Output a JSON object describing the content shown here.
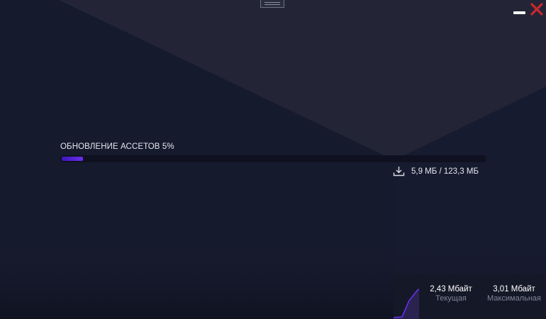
{
  "update": {
    "label": "ОБНОВЛЕНИЕ АССЕТОВ 5%",
    "progress_percent": 5,
    "downloaded": "5,9 МБ / 123,3 МБ"
  },
  "speed": {
    "current_value": "2,43 Мбайт",
    "current_caption": "Текущая",
    "max_value": "3,01 Мбайт",
    "max_caption": "Максимальная"
  },
  "icons": {
    "download": "download-icon",
    "minimize": "minimize-icon",
    "close": "close-icon",
    "drag": "drag-handle-icon"
  },
  "colors": {
    "background": "#161a2d",
    "accent": "#5b24e0",
    "close": "#c8282d"
  }
}
